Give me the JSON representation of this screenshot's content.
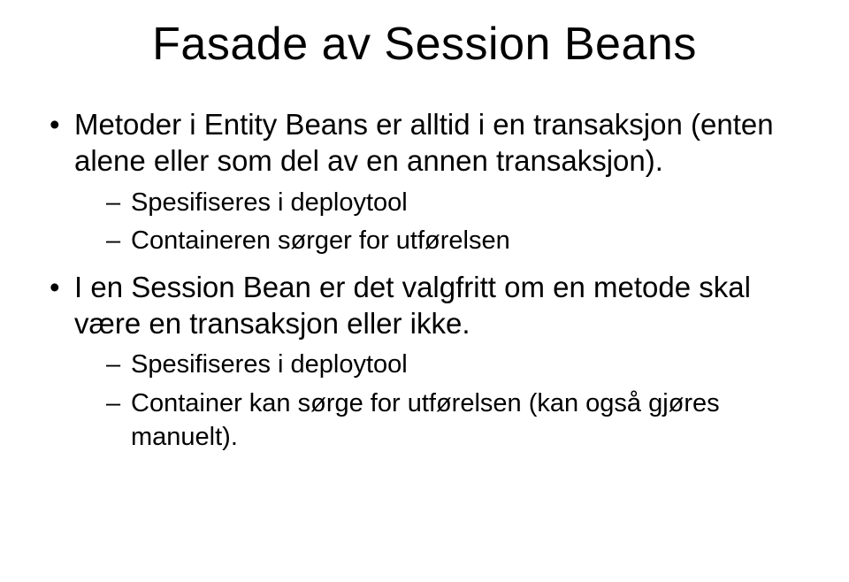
{
  "title": "Fasade av Session Beans",
  "bullets": [
    {
      "text": "Metoder i Entity Beans er alltid i en transaksjon (enten alene eller som del av en annen transaksjon).",
      "sub": [
        "Spesifiseres i deploytool",
        "Containeren sørger for utførelsen"
      ]
    },
    {
      "text": "I en Session Bean er det valgfritt om en metode skal være en transaksjon eller ikke.",
      "sub": [
        "Spesifiseres i deploytool",
        "Container kan sørge for utførelsen (kan også gjøres manuelt)."
      ]
    }
  ]
}
